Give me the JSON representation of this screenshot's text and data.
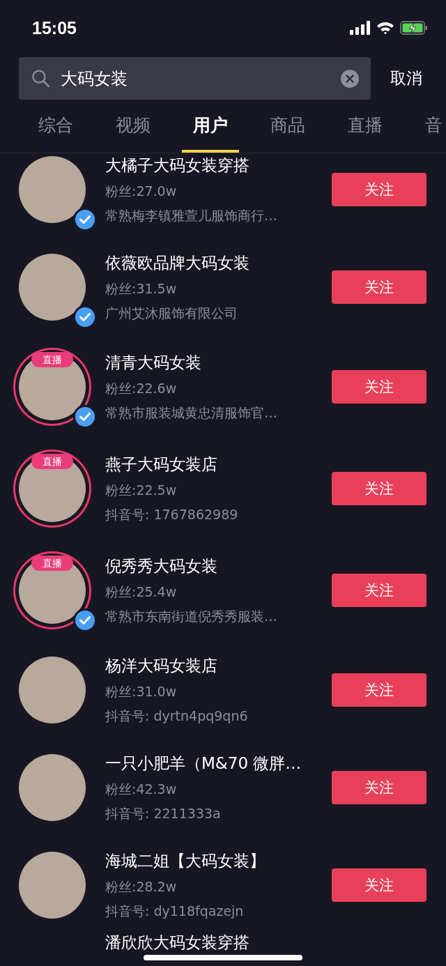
{
  "status_bar": {
    "time": "15:05"
  },
  "search": {
    "value": "大码女装",
    "cancel": "取消"
  },
  "tabs": [
    {
      "label": "综合",
      "selected": false
    },
    {
      "label": "视频",
      "selected": false
    },
    {
      "label": "用户",
      "selected": true
    },
    {
      "label": "商品",
      "selected": false
    },
    {
      "label": "直播",
      "selected": false
    },
    {
      "label": "音",
      "selected": false
    }
  ],
  "users": [
    {
      "name": "大橘子大码女装穿搭",
      "fans": "粉丝:27.0w",
      "subtitle": "常熟梅李镇雅萱儿服饰商行…",
      "verified": true,
      "live": false,
      "button": "关注"
    },
    {
      "name": "依薇欧品牌大码女装",
      "fans": "粉丝:31.5w",
      "subtitle": "广州艾沐服饰有限公司",
      "verified": true,
      "live": false,
      "button": "关注"
    },
    {
      "name": "清青大码女装",
      "fans": "粉丝:22.6w",
      "subtitle": "常熟市服装城黄忠清服饰官…",
      "verified": true,
      "live": true,
      "live_label": "直播",
      "button": "关注"
    },
    {
      "name": "燕子大码女装店",
      "fans": "粉丝:22.5w",
      "subtitle": "抖音号: 1767862989",
      "verified": false,
      "live": true,
      "live_label": "直播",
      "button": "关注"
    },
    {
      "name": "倪秀秀大码女装",
      "fans": "粉丝:25.4w",
      "subtitle": "常熟市东南街道倪秀秀服装…",
      "verified": true,
      "live": true,
      "live_label": "直播",
      "button": "关注"
    },
    {
      "name": "杨洋大码女装店",
      "fans": "粉丝:31.0w",
      "subtitle": "抖音号: dyrtn4pq9qn6",
      "verified": false,
      "live": false,
      "button": "关注"
    },
    {
      "name": "一只小肥羊（M&70 微胖…",
      "fans": "粉丝:42.3w",
      "subtitle": "抖音号: 2211333a",
      "verified": false,
      "live": false,
      "button": "关注"
    },
    {
      "name": "海城二姐【大码女装】",
      "fans": "粉丝:28.2w",
      "subtitle": "抖音号: dy118fqazejn",
      "verified": false,
      "live": false,
      "button": "关注"
    },
    {
      "name": "潘欣欣大码女装穿搭",
      "verified": false,
      "live": false
    }
  ]
}
